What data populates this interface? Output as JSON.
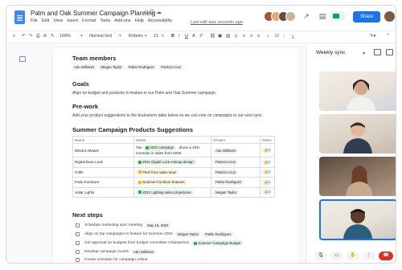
{
  "window": {
    "doc_title": "Palm and Oak Summer Campaign Planning",
    "menus": [
      "File",
      "Edit",
      "View",
      "Insert",
      "Format",
      "Tools",
      "Add-ons",
      "Help",
      "Accessibility"
    ],
    "last_edit": "Last edit was seconds ago",
    "share_label": "Share"
  },
  "toolbar": {
    "zoom": "100%",
    "style": "Normal text",
    "font": "Roboto",
    "size": "11"
  },
  "doc": {
    "team_heading": "Team members",
    "team_members": [
      "Adu Williams",
      "Megan Taylor",
      "Pablo Rodriguez",
      "Patricia Cruz"
    ],
    "goals_heading": "Goals",
    "goals_text": "Align on budget and products to feature in our Palm and Oak Summer campaign.",
    "prework_heading": "Pre-work",
    "prework_text": "Add your product suggestions to the brainstorm table below so we can vote on campaigns in our next sync.",
    "table_heading": "Summer Campaign Products Suggestions",
    "table_columns": [
      "Name",
      "Notes",
      "Creator",
      "Votes"
    ],
    "table_rows": [
      {
        "name": "Electric Mower",
        "note_prefix": "Our",
        "note_chip": "2020 campaign",
        "note_suffix": "drove a 10% increase in sales from 2019",
        "creator": "Adu Williams",
        "votes": "3"
      },
      {
        "name": "Digital Door Lock",
        "note_chip": "2021 Digital Lock endcap design",
        "creator": "Patricia Cruz",
        "votes": "1"
      },
      {
        "name": "Grills",
        "note_chip": "Pitch from sales team",
        "creator": "Patricia Cruz",
        "votes": "2"
      },
      {
        "name": "Patio Furniture",
        "note_chip": "Summer Furniture features",
        "creator": "Pablo Rodriguez",
        "votes": "1"
      },
      {
        "name": "Solar Lights",
        "note_chip": "2021 Lighting sales projections",
        "creator": "Megan Taylor",
        "votes": "2"
      }
    ],
    "next_heading": "Next steps",
    "next_steps": [
      {
        "text": "Schedule marketing sync meeting",
        "chips": [
          "May 18, 2021"
        ]
      },
      {
        "text": "Align on top campaigns to feature for Summer 2021",
        "chips": [
          "Megan Taylor",
          "Pablo Rodriguez"
        ]
      },
      {
        "text": "Get approval on budgets from budget committee Chairperson",
        "chips": [
          "Summer Campaign Budget"
        ]
      },
      {
        "text": "Develop campaign mocks",
        "chips": [
          "Adu Williams"
        ]
      },
      {
        "text": "Create schedule for campaign rollout",
        "chips": []
      }
    ]
  },
  "meet": {
    "title": "Weekly sync"
  },
  "colors": {
    "accent": "#1a73e8",
    "end_call": "#d93025"
  }
}
